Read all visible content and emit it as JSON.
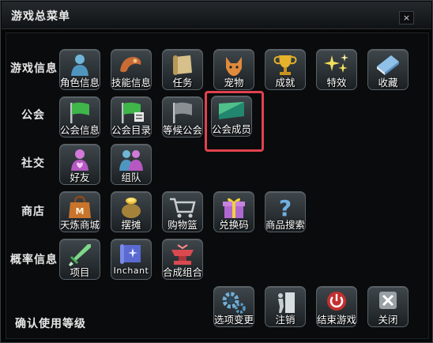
{
  "window": {
    "title": "游戏总菜单",
    "close": "×"
  },
  "sections": [
    {
      "label": "游戏信息"
    },
    {
      "label": "公会"
    },
    {
      "label": "社交"
    },
    {
      "label": "商店"
    },
    {
      "label": "概率信息"
    }
  ],
  "buttons": {
    "role_info": "角色信息",
    "skill_info": "技能信息",
    "quest": "任务",
    "pet": "宠物",
    "achievement": "成就",
    "special": "特效",
    "collection": "收藏",
    "guild_info": "公会信息",
    "guild_list": "公会目录",
    "guild_wait": "等候公会",
    "guild_members": "公会成员",
    "friends": "好友",
    "party": "组队",
    "tianlian_shop": "天炼商城",
    "stall": "摆摊",
    "cart": "购物篮",
    "redeem": "兑换码",
    "item_search": "商品搜索",
    "item_prob": "项目",
    "enchant": "Inchant",
    "combine": "合成组合",
    "options": "选项变更",
    "logout": "注销",
    "exit_game": "结束游戏",
    "close_menu": "关闭"
  },
  "footer": {
    "label": "确认使用等级"
  },
  "colors": {
    "highlight": "#e0424f",
    "flag_green": "#3fb54a",
    "flag_gray": "#8a8f93"
  }
}
